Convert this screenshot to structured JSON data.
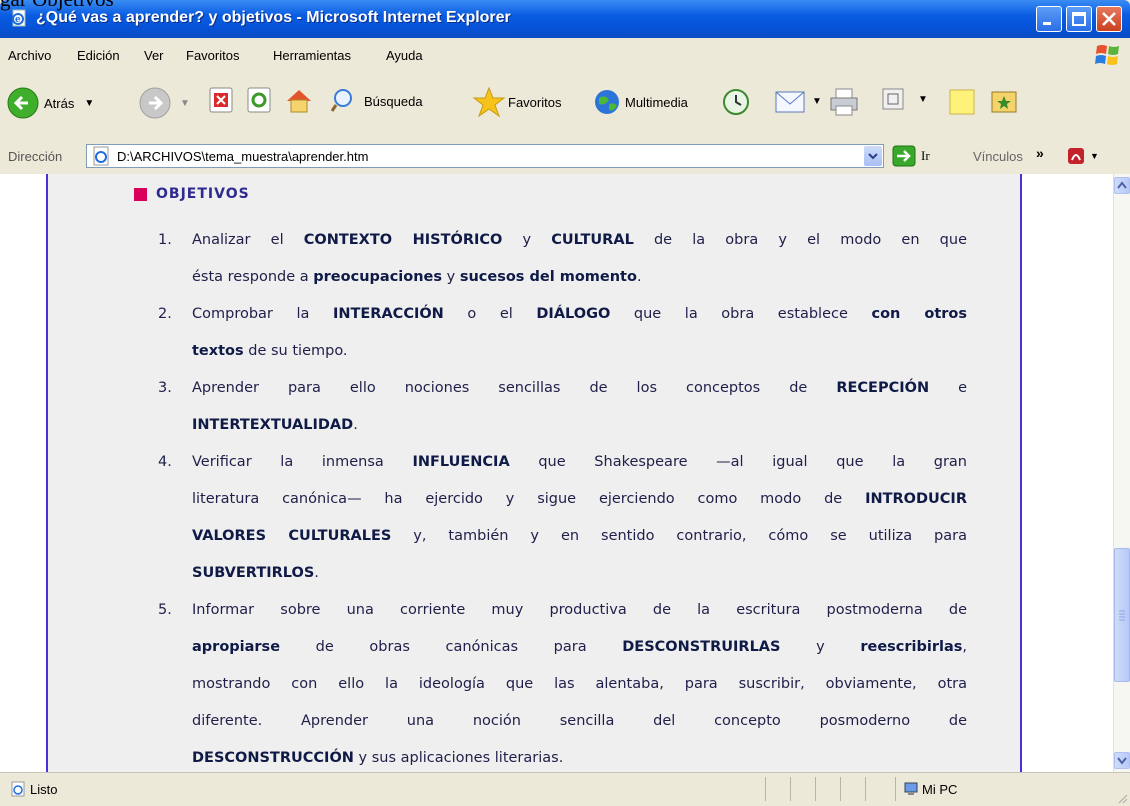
{
  "window": {
    "title": "¿Qué vas a aprender? y objetivos - Microsoft Internet Explorer"
  },
  "menubar": {
    "items": [
      "Archivo",
      "Edición",
      "Ver",
      "Favoritos",
      "Herramientas",
      "Ayuda"
    ]
  },
  "toolbar": {
    "back_label": "Atrás",
    "search_label": "Búsqueda",
    "favorites_label": "Favoritos",
    "media_label": "Multimedia"
  },
  "addressbar": {
    "label": "Dirección",
    "url": "D:\\ARCHIVOS\\tema_muestra\\aprender.htm",
    "go_label": "Ir",
    "links_label": "Vínculos"
  },
  "content": {
    "heading": "OBJETIVOS",
    "objectives": [
      {
        "number": "1.",
        "lines": [
          [
            "Analizar el ",
            "CONTEXTO HISTÓRICO",
            " y ",
            "CULTURAL",
            " de la obra y el modo en que"
          ],
          [
            "ésta responde a ",
            "preocupaciones",
            " y ",
            "sucesos del momento",
            "."
          ]
        ]
      },
      {
        "number": "2.",
        "lines": [
          [
            "Comprobar la ",
            "INTERACCIÓN",
            " o el ",
            "DIÁLOGO",
            " que la obra establece ",
            "con otros"
          ],
          [
            "",
            "textos",
            " de su tiempo."
          ]
        ]
      },
      {
        "number": "3.",
        "lines": [
          [
            "Aprender para ello nociones sencillas de los conceptos de ",
            "RECEPCIÓN",
            " e"
          ],
          [
            "",
            "INTERTEXTUALIDAD",
            "."
          ]
        ]
      },
      {
        "number": "4.",
        "lines": [
          [
            "Verificar la inmensa ",
            "INFLUENCIA",
            " que Shakespeare —al igual que la gran"
          ],
          [
            "literatura canónica— ha ejercido y sigue ejerciendo como modo de ",
            "INTRODUCIR"
          ],
          [
            "",
            "VALORES CULTURALES",
            " y, también y en sentido contrario, cómo se utiliza para"
          ],
          [
            "",
            "SUBVERTIRLOS",
            "."
          ]
        ]
      },
      {
        "number": "5.",
        "lines": [
          [
            "Informar sobre una corriente muy productiva de la escritura postmoderna de"
          ],
          [
            "",
            "apropiarse",
            " de obras canónicas para ",
            "DESCONSTRUIRLAS",
            " y ",
            "reescribirlas",
            ","
          ],
          [
            "mostrando con ello la ideología que las alentaba, para suscribir, obviamente, otra"
          ],
          [
            "diferente. Aprender una noción sencilla del concepto posmoderno de"
          ],
          [
            "",
            "DESCONSTRUCCIÓN",
            " y sus aplicaciones literarias."
          ]
        ]
      }
    ]
  },
  "statusbar": {
    "status": "Listo",
    "zone": "Mi PC"
  },
  "outer_caption": "gar Objetivos"
}
